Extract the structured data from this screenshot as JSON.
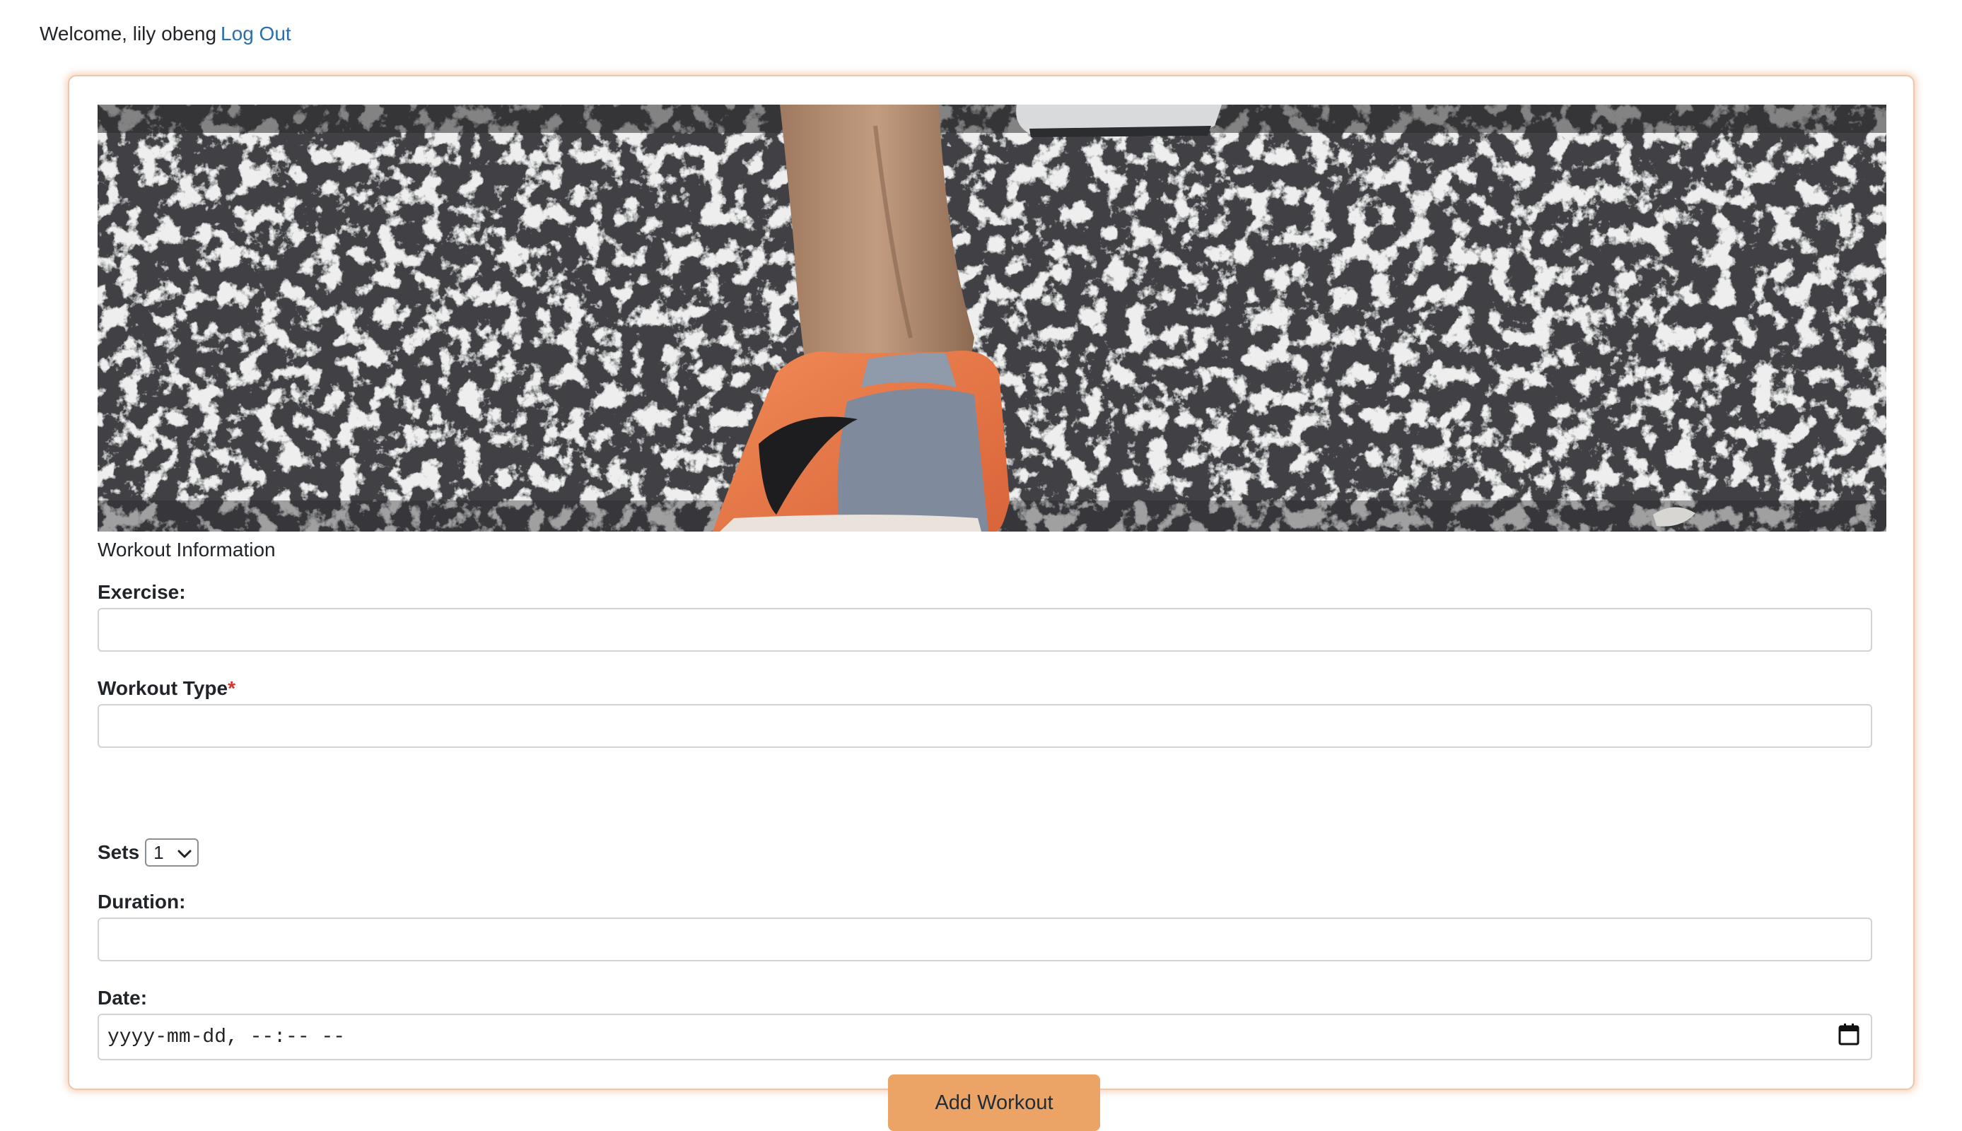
{
  "header": {
    "welcome_text": "Welcome, lily obeng",
    "logout_label": "Log Out"
  },
  "hero": {
    "image_name": "hero-image"
  },
  "form": {
    "section_title": "Workout Information",
    "exercise_label": "Exercise:",
    "exercise_value": "",
    "workout_type_label": "Workout Type",
    "required_marker": "*",
    "workout_type_value": "",
    "sets_label": "Sets",
    "sets_selected": "1",
    "duration_label": "Duration:",
    "duration_value": "",
    "date_label": "Date:",
    "date_placeholder": "yyyy-mm-dd, --:-- --",
    "submit_label": "Add Workout"
  },
  "colors": {
    "accent": "#eba466",
    "card_glow": "#f0c6a8",
    "link": "#2a6fb0",
    "required": "#d9342b"
  },
  "icons": {
    "select": "chevron-down-icon",
    "date": "calendar-icon"
  }
}
